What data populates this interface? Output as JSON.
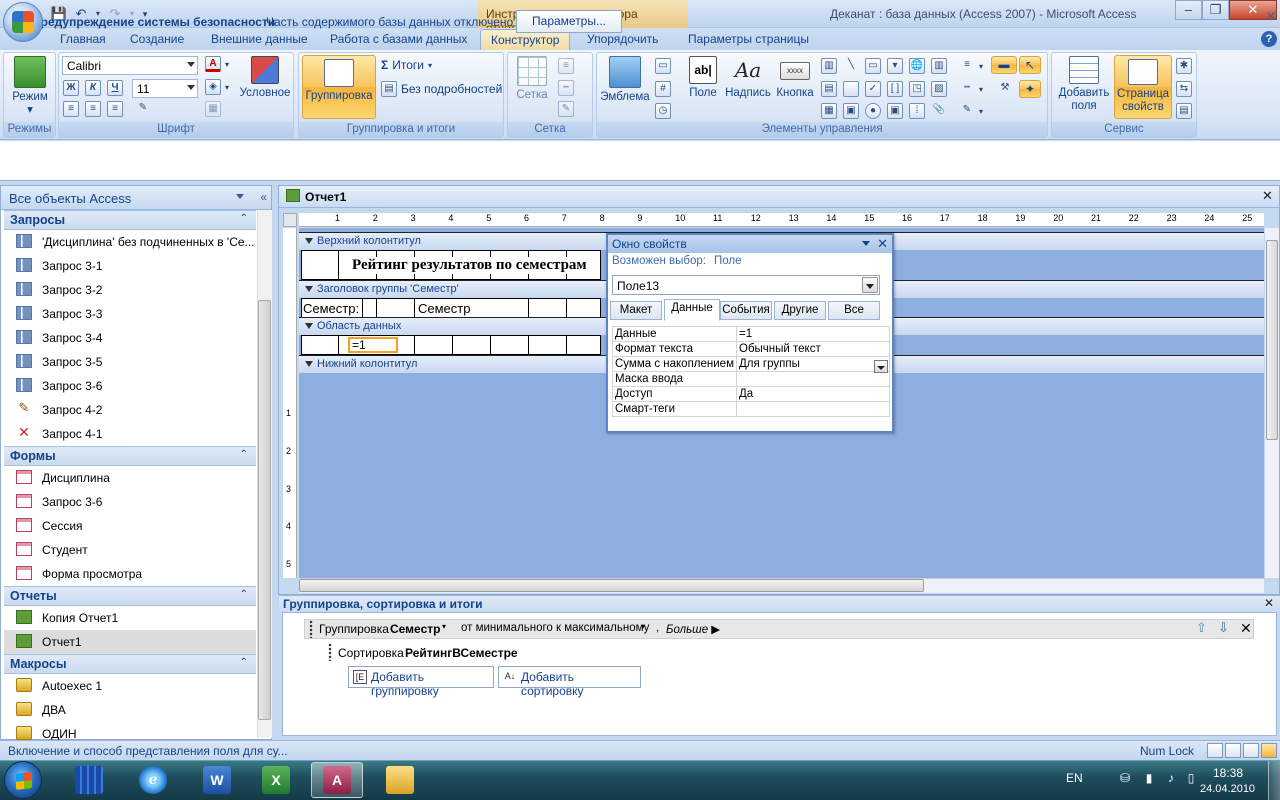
{
  "titlebar": {
    "context_title": "Инструменты конструктора отчетов",
    "app_title": "Деканат : база данных (Access 2007)  -  Microsoft Access"
  },
  "tabs": [
    {
      "label": "Главная"
    },
    {
      "label": "Создание"
    },
    {
      "label": "Внешние данные"
    },
    {
      "label": "Работа с базами данных"
    },
    {
      "label": "Конструктор"
    },
    {
      "label": "Упорядочить"
    },
    {
      "label": "Параметры страницы"
    }
  ],
  "ribbon": {
    "modes": {
      "label": "Режимы",
      "view_button": "Режим"
    },
    "font": {
      "label": "Шрифт",
      "font_name": "Calibri",
      "font_size": "11",
      "bold": "Ж",
      "italic": "К",
      "underline": "Ч",
      "conditional": "Условное"
    },
    "grouping": {
      "label": "Группировка и итоги",
      "group_button": "Группировка",
      "totals": "Итоги",
      "hide_details": "Без подробностей"
    },
    "grid": {
      "label": "Сетка",
      "grid_button": "Сетка"
    },
    "controls": {
      "label": "Элементы управления",
      "logo": "Эмблема",
      "field": "Поле",
      "label_btn": "Надпись",
      "button": "Кнопка",
      "field_icon_text": "ab|",
      "label_icon_text": "Aa",
      "button_icon_text": "xxxx"
    },
    "tools": {
      "label": "Сервис",
      "add_field": "Добавить поля",
      "property_sheet": "Страница свойств"
    }
  },
  "security": {
    "title": "Предупреждение системы безопасности",
    "message": "Часть содержимого базы данных отключено",
    "button": "Параметры..."
  },
  "nav": {
    "header": "Все объекты Access",
    "groups": [
      {
        "title": "Запросы",
        "items": [
          {
            "label": "'Дисциплина' без подчиненных в 'Се...",
            "icon": "query-icon"
          },
          {
            "label": "Запрос 3-1",
            "icon": "query-icon"
          },
          {
            "label": "Запрос 3-2",
            "icon": "query-icon"
          },
          {
            "label": "Запрос 3-3",
            "icon": "query-icon"
          },
          {
            "label": "Запрос 3-4",
            "icon": "query-icon"
          },
          {
            "label": "Запрос 3-5",
            "icon": "query-icon"
          },
          {
            "label": "Запрос 3-6",
            "icon": "query-icon"
          },
          {
            "label": "Запрос 4-2",
            "icon": "update-query-icon"
          },
          {
            "label": "Запрос 4-1",
            "icon": "delete-query-icon"
          }
        ]
      },
      {
        "title": "Формы",
        "items": [
          {
            "label": "Дисциплина",
            "icon": "form-icon"
          },
          {
            "label": "Запрос 3-6",
            "icon": "form-icon"
          },
          {
            "label": "Сессия",
            "icon": "form-icon"
          },
          {
            "label": "Студент",
            "icon": "form-icon"
          },
          {
            "label": "Форма просмотра",
            "icon": "form-icon"
          }
        ]
      },
      {
        "title": "Отчеты",
        "items": [
          {
            "label": "Копия Отчет1",
            "icon": "report-icon"
          },
          {
            "label": "Отчет1",
            "icon": "report-icon",
            "selected": true
          }
        ]
      },
      {
        "title": "Макросы",
        "items": [
          {
            "label": "Autoexec 1",
            "icon": "macro-icon"
          },
          {
            "label": "ДВА",
            "icon": "macro-icon"
          },
          {
            "label": "ОДИН",
            "icon": "macro-icon"
          }
        ]
      }
    ]
  },
  "document": {
    "tab_title": "Отчет1",
    "ruler_numbers": [
      "1",
      "2",
      "3",
      "4",
      "5",
      "6",
      "7",
      "8",
      "9",
      "10",
      "11",
      "12",
      "13",
      "14",
      "15",
      "16",
      "17",
      "18",
      "19",
      "20",
      "21",
      "22",
      "23",
      "24",
      "25"
    ],
    "vruler_numbers": [
      "1",
      "2",
      "3",
      "4",
      "5"
    ],
    "bands": {
      "page_header": "Верхний колонтитул",
      "group_header": "Заголовок группы 'Семестр'",
      "detail": "Область данных",
      "page_footer": "Нижний колонтитул"
    },
    "header_text": "Рейтинг результатов по семестрам",
    "semester_label": "Семестр:",
    "semester_field": "Семестр",
    "detail_field": "=1"
  },
  "property_sheet": {
    "title": "Окно свойств",
    "selection_type_label": "Возможен выбор:",
    "selection_type_value": "Поле",
    "object_combo": "Поле13",
    "tabs": [
      "Макет",
      "Данные",
      "События",
      "Другие",
      "Все"
    ],
    "active_tab": "Данные",
    "rows": [
      {
        "key": "Данные",
        "value": "=1"
      },
      {
        "key": "Формат текста",
        "value": "Обычный текст"
      },
      {
        "key": "Сумма с накоплением",
        "value": "Для группы"
      },
      {
        "key": "Маска ввода",
        "value": ""
      },
      {
        "key": "Доступ",
        "value": "Да"
      },
      {
        "key": "Смарт-теги",
        "value": ""
      }
    ]
  },
  "grouping_pane": {
    "title": "Группировка, сортировка и итоги",
    "group_prefix": "Группировка",
    "group_field": "Семестр",
    "group_order": "от минимального к максимальному",
    "more": "Больше ▶",
    "sort_prefix": "Сортировка",
    "sort_field": "РейтингВСеместре",
    "add_group": "Добавить группировку",
    "add_sort": "Добавить сортировку"
  },
  "status": {
    "text": "Включение и способ представления поля для су...",
    "numlock": "Num Lock"
  },
  "taskbar": {
    "lang": "EN",
    "time": "18:38",
    "date": "24.04.2010"
  },
  "colors": {
    "ribbon_blue": "#dbe7f6",
    "accent_orange": "#f7b43b",
    "design_surface": "#8eaee0",
    "text_blue": "#15428b"
  }
}
